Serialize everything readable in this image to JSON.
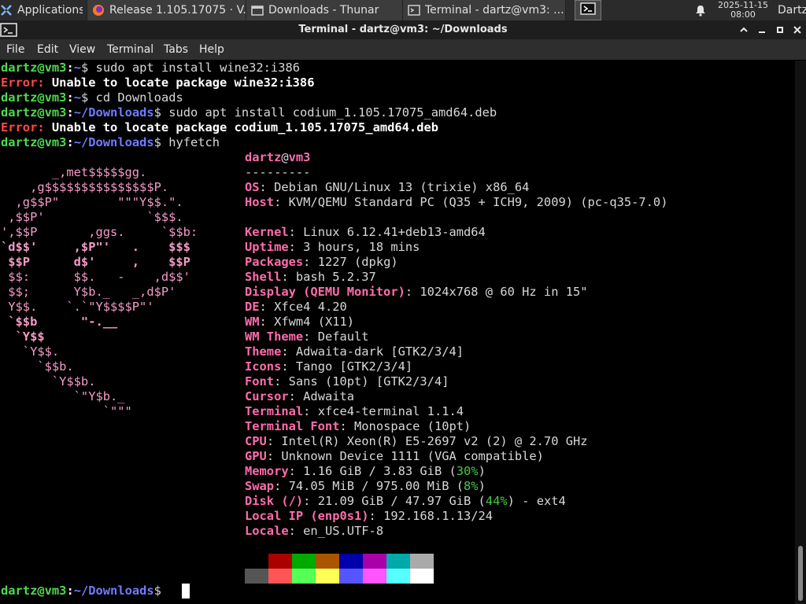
{
  "panel": {
    "applications_label": "Applications",
    "tasks": [
      {
        "label": "Release 1.105.17075 · V...",
        "icon": "firefox-icon"
      },
      {
        "label": "Downloads - Thunar",
        "icon": "folder-window-icon"
      },
      {
        "label": "Terminal - dartz@vm3: ...",
        "icon": "terminal-window-icon"
      }
    ],
    "clock": {
      "date": "2025-11-15",
      "time": "08:00"
    },
    "user": "Dartz"
  },
  "window": {
    "title": "Terminal - dartz@vm3: ~/Downloads",
    "menu": [
      "File",
      "Edit",
      "View",
      "Terminal",
      "Tabs",
      "Help"
    ]
  },
  "terminal": {
    "user": "dartz",
    "host": "vm3",
    "commands": [
      {
        "cwd": "~",
        "cmd": "sudo apt install wine32:i386"
      },
      {
        "cwd": "~",
        "cmd": "cd Downloads"
      },
      {
        "cwd": "~/Downloads",
        "cmd": "sudo apt install codium_1.105.17075_amd64.deb"
      },
      {
        "cwd": "~/Downloads",
        "cmd": "hyfetch"
      },
      {
        "cwd": "~/Downloads",
        "cmd": ""
      }
    ],
    "errors": [
      {
        "label": "Error:",
        "message": "Unable to locate package wine32:i386"
      },
      {
        "label": "Error:",
        "message": "Unable to locate package codium_1.105.17075_amd64.deb"
      }
    ],
    "logo": [
      "       _,met$$$$$gg.",
      "    ,g$$$$$$$$$$$$$$$P.",
      "  ,g$$P\"        \"\"\"Y$$.\".",
      " ,$$P'              `$$$.",
      "',$$P       ,ggs.     `$$b:",
      "`d$$'     ,$P\"'   .    $$$",
      " $$P      d$'     ,    $$P",
      " $$:      $$.   -    ,d$$'",
      " $$;      Y$b._   _,d$P'",
      " Y$$.    `.`\"Y$$$$P\"'",
      " `$$b      \"-.__",
      "  `Y$$",
      "   `Y$$.",
      "     `$$b.",
      "       `Y$$b.",
      "          `\"Y$b._",
      "              `\"\"\""
    ],
    "sysinfo_user": "dartz",
    "sysinfo_host": "vm3",
    "separator": "---------",
    "info": [
      {
        "key": "OS",
        "value": "Debian GNU/Linux 13 (trixie) x86_64"
      },
      {
        "key": "Host",
        "value": "KVM/QEMU Standard PC (Q35 + ICH9, 2009) (pc-q35-7.0)"
      },
      {
        "key": "Kernel",
        "value": "Linux 6.12.41+deb13-amd64"
      },
      {
        "key": "Uptime",
        "value": "3 hours, 18 mins"
      },
      {
        "key": "Packages",
        "value": "1227 (dpkg)"
      },
      {
        "key": "Shell",
        "value": "bash 5.2.37"
      },
      {
        "key": "Display (QEMU Monitor)",
        "value": "1024x768 @ 60 Hz in 15\""
      },
      {
        "key": "DE",
        "value": "Xfce4 4.20"
      },
      {
        "key": "WM",
        "value": "Xfwm4 (X11)"
      },
      {
        "key": "WM Theme",
        "value": "Default"
      },
      {
        "key": "Theme",
        "value": "Adwaita-dark [GTK2/3/4]"
      },
      {
        "key": "Icons",
        "value": "Tango [GTK2/3/4]"
      },
      {
        "key": "Font",
        "value": "Sans (10pt) [GTK2/3/4]"
      },
      {
        "key": "Cursor",
        "value": "Adwaita"
      },
      {
        "key": "Terminal",
        "value": "xfce4-terminal 1.1.4"
      },
      {
        "key": "Terminal Font",
        "value": "Monospace (10pt)"
      },
      {
        "key": "CPU",
        "value": "Intel(R) Xeon(R) E5-2697 v2 (2) @ 2.70 GHz"
      },
      {
        "key": "GPU",
        "value": "Unknown Device 1111 (VGA compatible)"
      }
    ],
    "memory": {
      "key": "Memory",
      "value": "1.16 GiB / 3.83 GiB",
      "percent": "30%"
    },
    "swap": {
      "key": "Swap",
      "value": "74.05 MiB / 975.00 MiB",
      "percent": "8%"
    },
    "disk": {
      "key": "Disk (/)",
      "value": "21.09 GiB / 47.97 GiB",
      "percent": "44%",
      "fs": "ext4"
    },
    "local_ip": {
      "key": "Local IP (enp0s1)",
      "value": "192.168.1.13/24"
    },
    "locale": {
      "key": "Locale",
      "value": "en_US.UTF-8"
    },
    "palette": {
      "normal": [
        "#000000",
        "#aa0000",
        "#00aa00",
        "#aa5500",
        "#0000aa",
        "#aa00aa",
        "#00aaaa",
        "#aaaaaa"
      ],
      "bright": [
        "#555555",
        "#ff5555",
        "#55ff55",
        "#ffff55",
        "#5555ff",
        "#ff55ff",
        "#55ffff",
        "#ffffff"
      ]
    }
  },
  "colors": {
    "prompt_user": "#4fd94f",
    "prompt_path": "#6f7cff",
    "error": "#ff4848",
    "info_key": "#ff6dad",
    "percent_green": "#44cc44"
  }
}
